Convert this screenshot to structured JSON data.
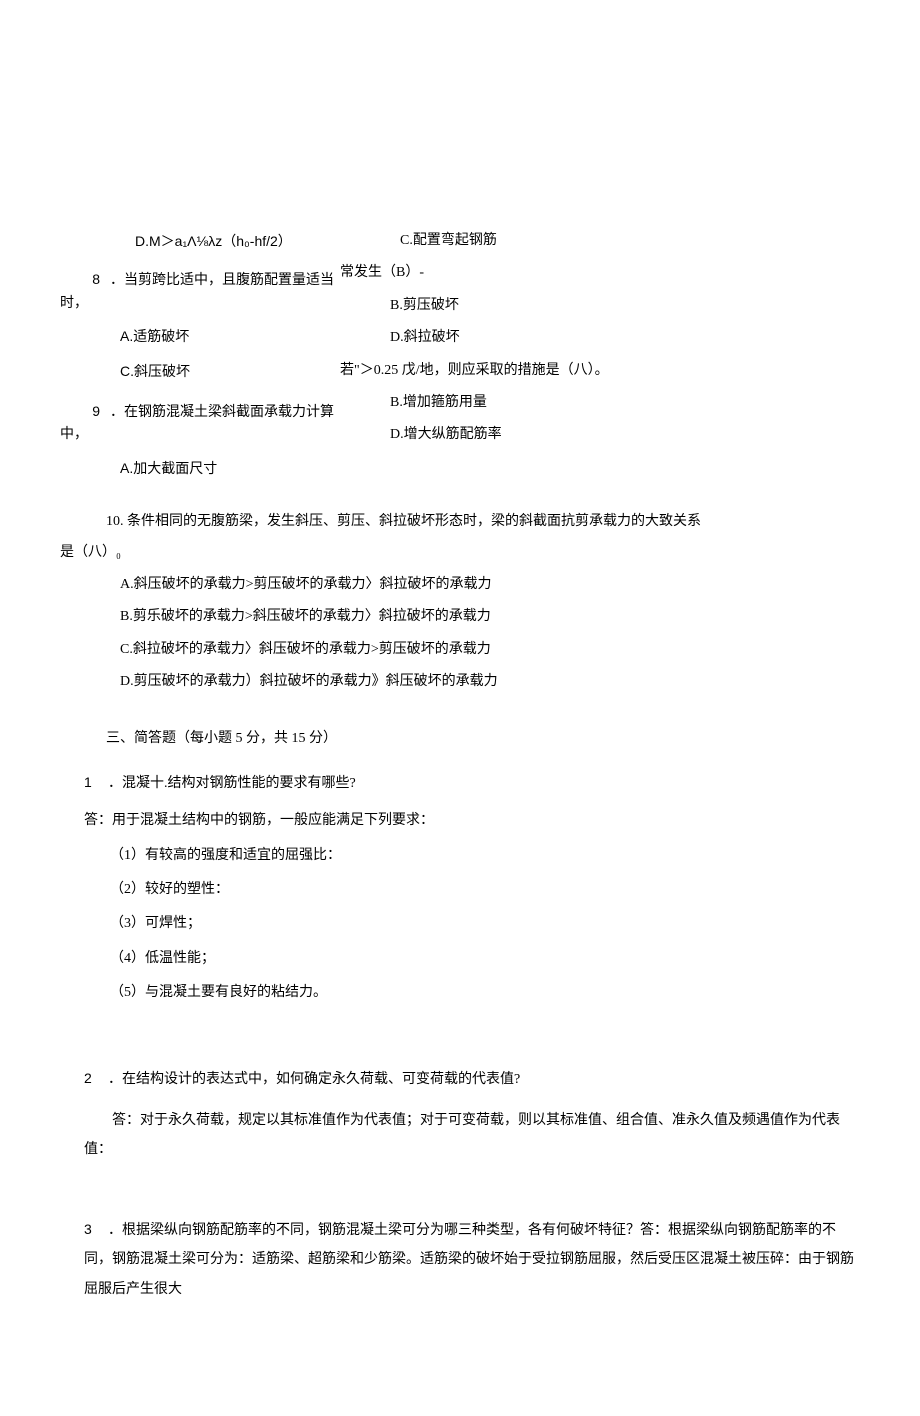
{
  "top": {
    "optionD": "D.M＞a₁Λ⅛λz（h₀-hf/2）",
    "q8": {
      "num": "8",
      "text": "．当剪跨比适中，且腹筋配置量适当时，",
      "optA": "A.适筋破坏",
      "optC": "C.斜压破坏"
    },
    "q9": {
      "num": "9",
      "text": "．在钢筋混凝土梁斜截面承载力计算中，",
      "optA": "A.加大截面尺寸"
    },
    "right": {
      "optC1": "C.配置弯起钢筋",
      "line1": "常发生（B）-",
      "optB1": "B.剪压破坏",
      "optD1": "D.斜拉破坏",
      "line2": "若\"＞0.25 戊/地，则应采取的措施是（八）。",
      "optB2": "B.增加箍筋用量",
      "optD2": "D.增大纵筋配筋率"
    }
  },
  "q10": {
    "text": "10.  条件相同的无腹筋梁，发生斜压、剪压、斜拉破坏形态时，梁的斜截面抗剪承载力的大致关系",
    "cont": "是（八）₀",
    "optA": "A.斜压破坏的承载力>剪压破坏的承载力〉斜拉破坏的承载力",
    "optB": "B.剪乐破坏的承载力>斜压破坏的承载力〉斜拉破坏的承载力",
    "optC": "C.斜拉破坏的承载力〉斜压破坏的承载力>剪压破坏的承载力",
    "optD": "D.剪压破坏的承载力）斜拉破坏的承载力》斜压破坏的承载力"
  },
  "section3": {
    "title": "三、简答题（每小题 5 分，共 15 分）",
    "q1": {
      "num": "1",
      "text": "．混凝十.结构对钢筋性能的要求有哪些?",
      "ans": "答：用于混凝土结构中的钢筋，一般应能满足下列要求：",
      "items": {
        "i1": "（1）有较高的强度和适宜的屈强比：",
        "i2": "（2）较好的塑性：",
        "i3": "（3）可焊性；",
        "i4": "（4）低温性能；",
        "i5": "（5）与混凝土要有良好的粘结力。"
      }
    },
    "q2": {
      "num": "2",
      "text": "．在结构设计的表达式中，如何确定永久荷载、可变荷载的代表值?",
      "ans": "答：对于永久荷载，规定以其标准值作为代表值；对于可变荷载，则以其标准值、组合值、准永久值及频遇值作为代表值："
    },
    "q3": {
      "num": "3",
      "text": "．根据梁纵向钢筋配筋率的不同，钢筋混凝土梁可分为哪三种类型，各有何破坏特征？答：根据梁纵向钢筋配筋率的不同，钢筋混凝土梁可分为：适筋梁、超筋梁和少筋梁。适筋梁的破坏始于受拉钢筋屈服，然后受压区混凝土被压碎：由于钢筋屈服后产生很大"
    }
  }
}
